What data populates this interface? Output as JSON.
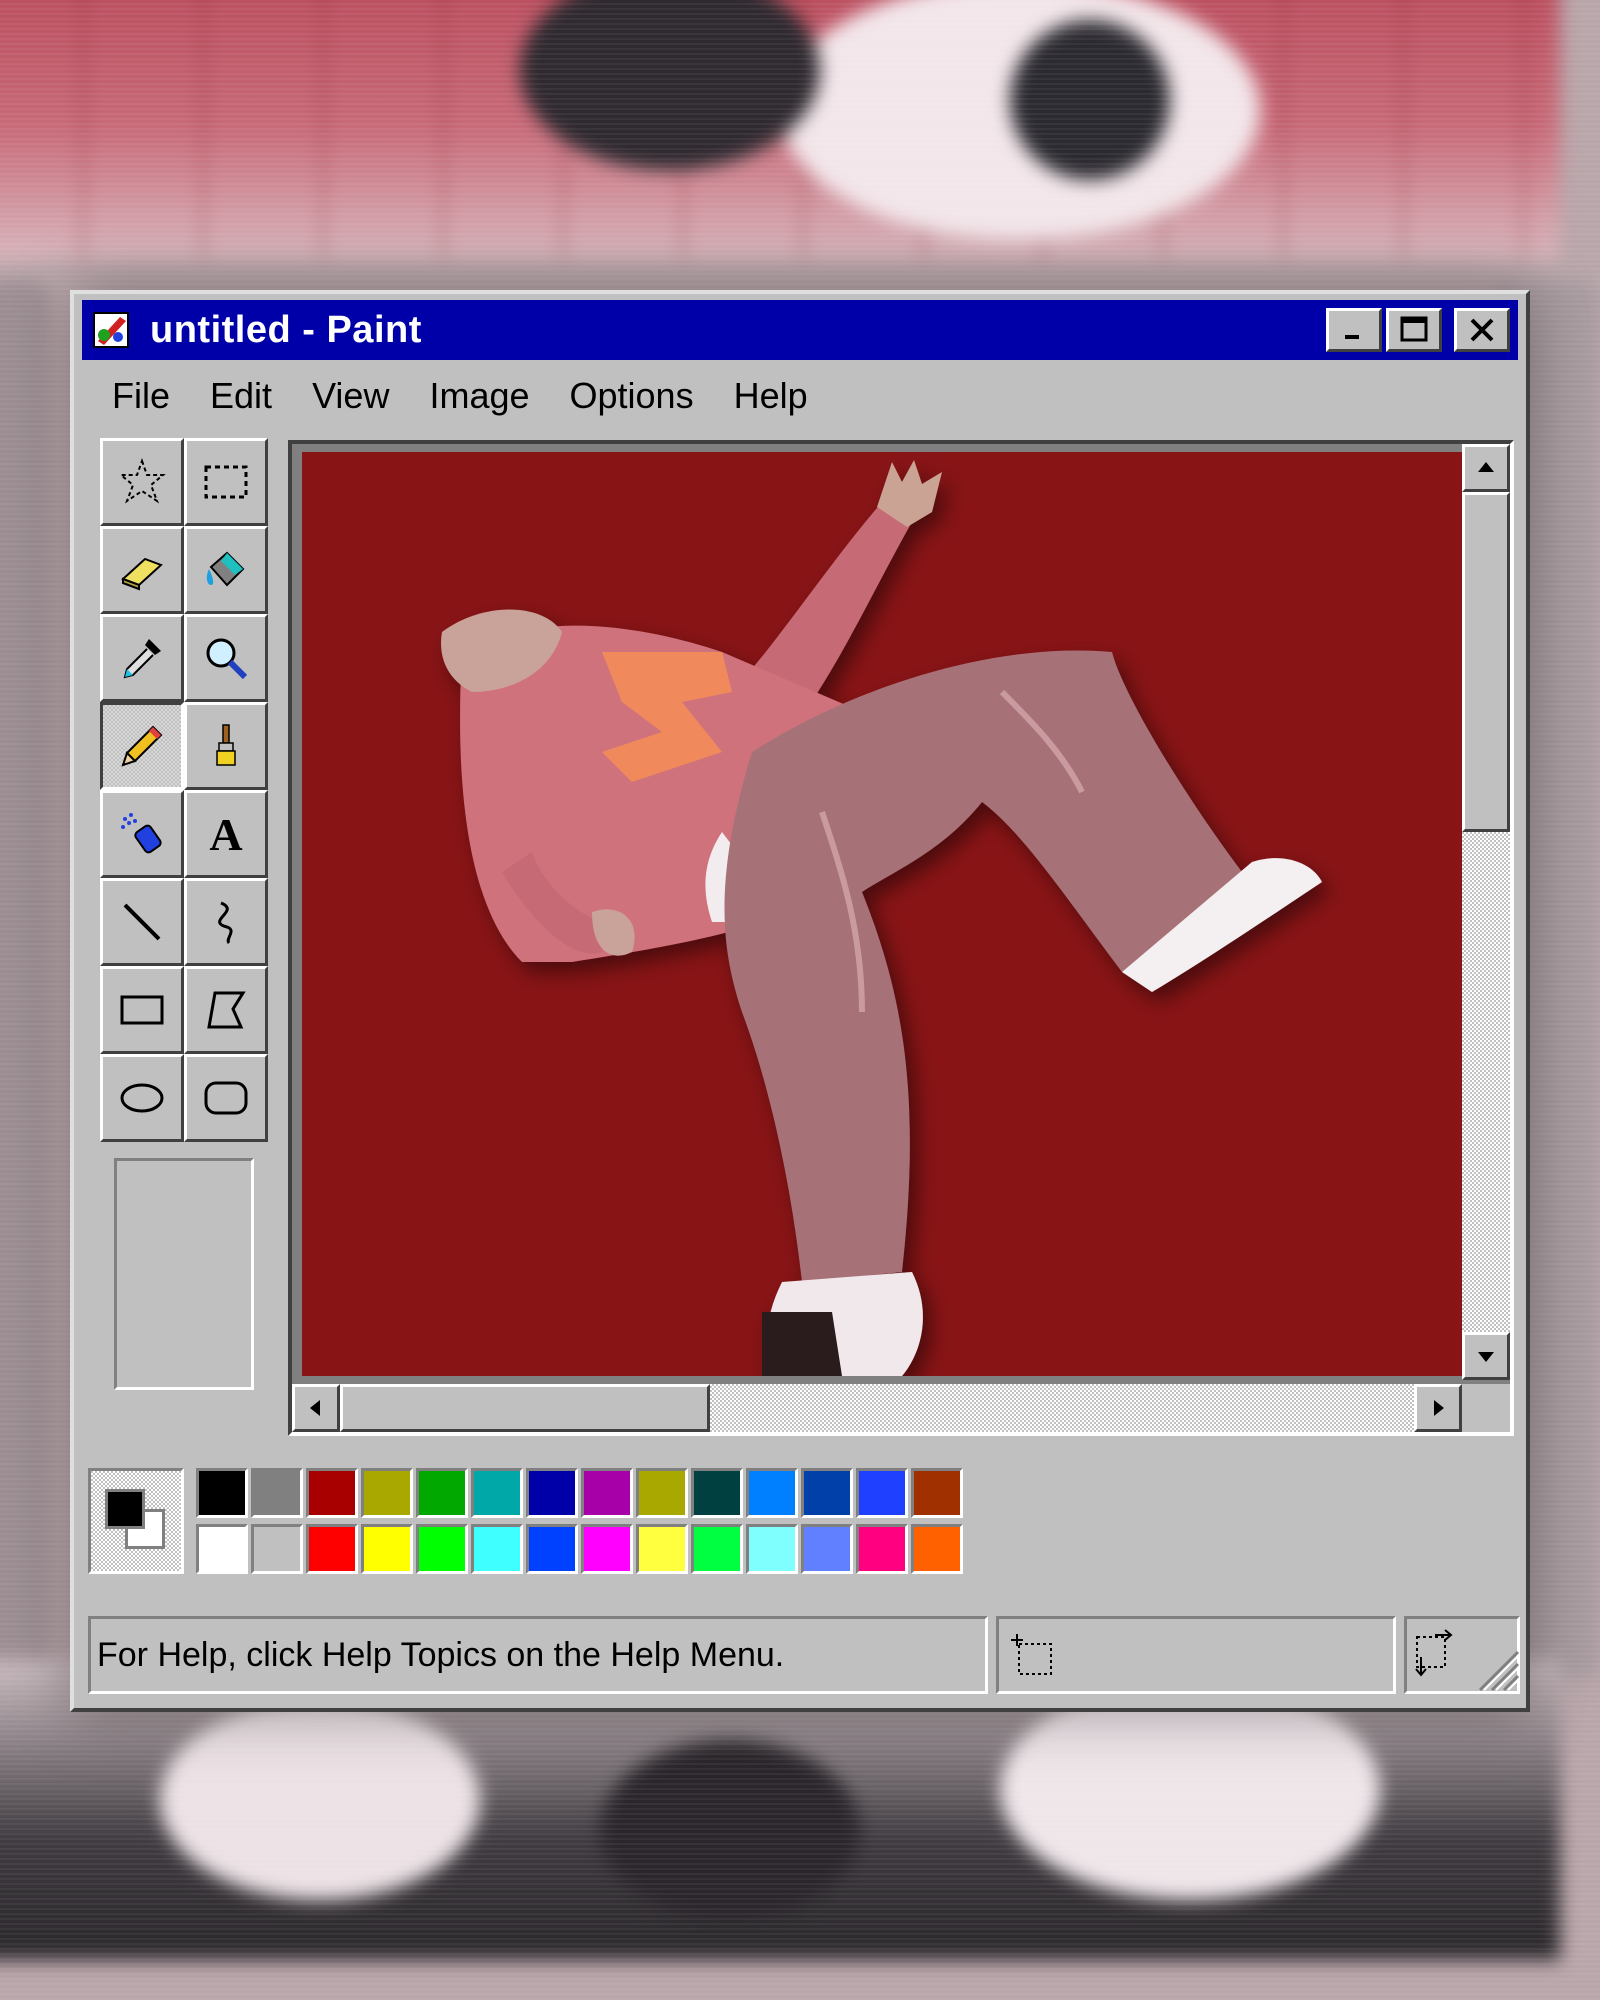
{
  "window": {
    "title": "untitled - Paint",
    "title_color": "#0000a8",
    "controls": [
      "minimize-icon",
      "maximize-icon",
      "close-icon"
    ]
  },
  "menubar": {
    "items": [
      "File",
      "Edit",
      "View",
      "Image",
      "Options",
      "Help"
    ]
  },
  "toolbox": {
    "tools": [
      "free-form-select-icon",
      "rectangle-select-icon",
      "eraser-icon",
      "fill-bucket-icon",
      "color-picker-icon",
      "magnifier-icon",
      "pencil-icon",
      "brush-icon",
      "airbrush-icon",
      "text-icon",
      "line-icon",
      "curve-icon",
      "rectangle-icon",
      "polygon-icon",
      "ellipse-icon",
      "rounded-rectangle-icon"
    ],
    "active_tool": "pencil-icon",
    "text_tool_glyph": "A"
  },
  "canvas": {
    "background_color": "#881416",
    "image": "photo of a person in a pink hoodie and faded pants leaning back"
  },
  "palette": {
    "foreground": "#000000",
    "background": "#ffffff",
    "row1": [
      "#000000",
      "#808080",
      "#a80000",
      "#a8a800",
      "#00a800",
      "#00a8a8",
      "#0000a8",
      "#a800a8",
      "#a8a800",
      "#004040",
      "#0080ff",
      "#0040a8",
      "#2040ff",
      "#a03000"
    ],
    "row2": [
      "#ffffff",
      "#c0c0c0",
      "#ff0000",
      "#ffff00",
      "#00ff00",
      "#40ffff",
      "#0040ff",
      "#ff00ff",
      "#ffff40",
      "#00ff40",
      "#80ffff",
      "#6080ff",
      "#ff0080",
      "#ff6000"
    ]
  },
  "statusbar": {
    "help_text": "For Help, click Help Topics on the Help Menu."
  }
}
